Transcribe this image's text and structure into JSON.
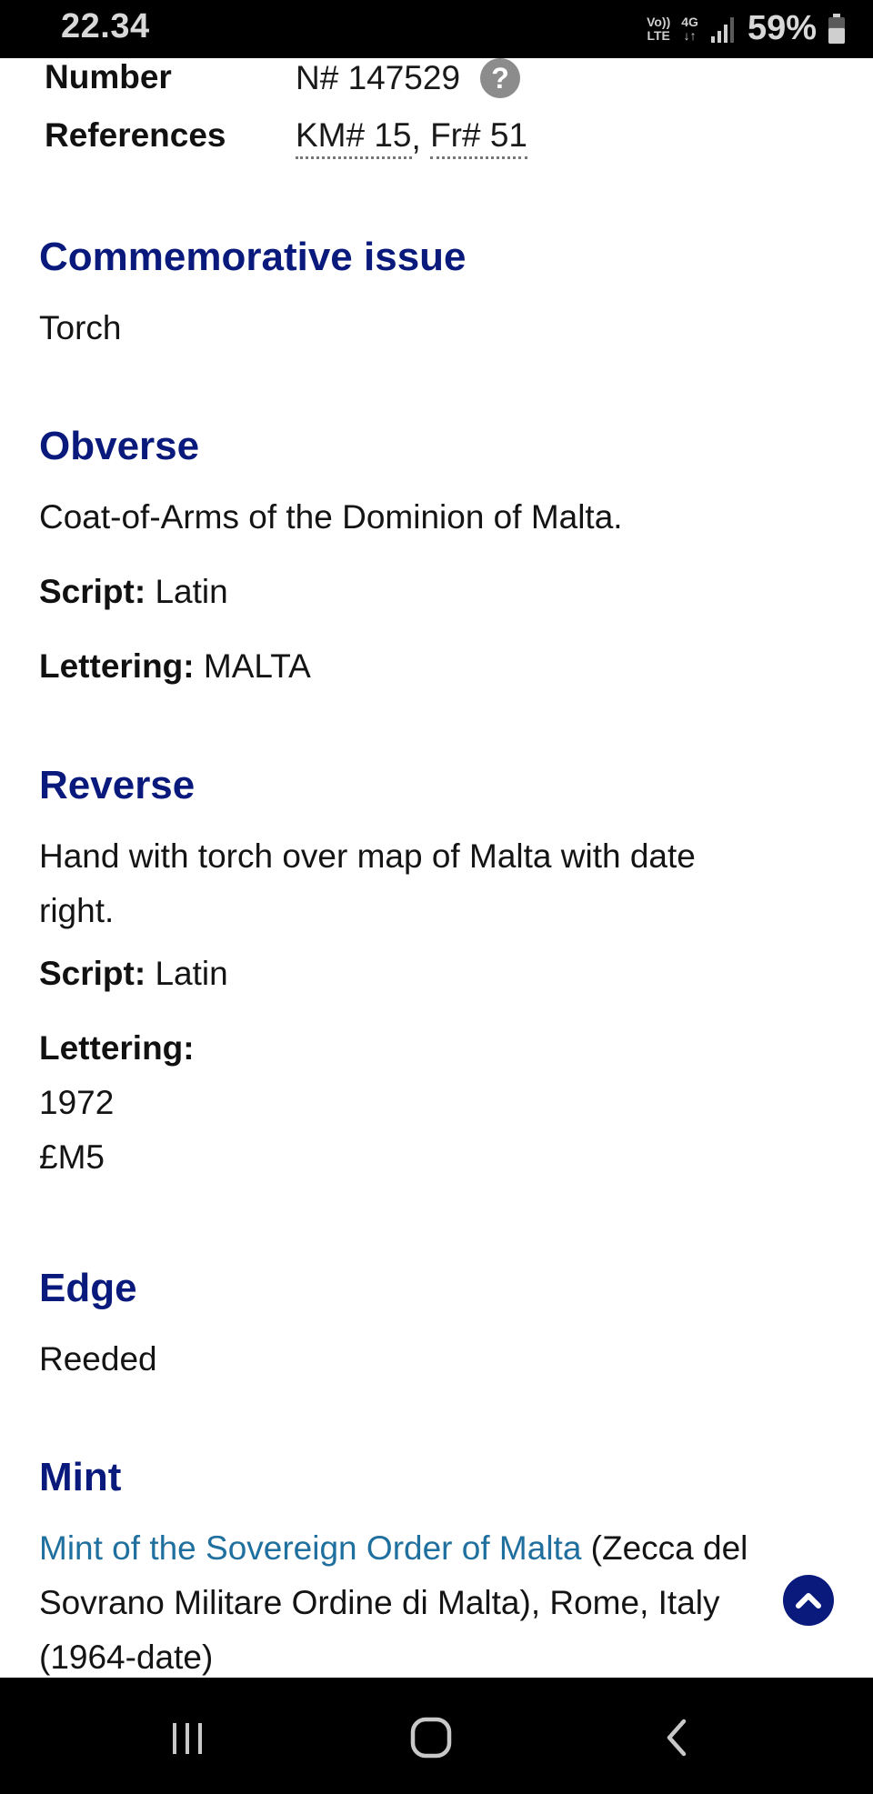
{
  "status_bar": {
    "time": "22.34",
    "volte_line1": "Vo))",
    "volte_line2": "LTE",
    "network_line1": "4G",
    "network_line2": "↓↑",
    "battery_percent": "59%",
    "battery_level": 0.59
  },
  "details": {
    "number_label": "Number",
    "number_value": "N# 147529",
    "references_label": "References",
    "references": [
      "KM# 15",
      "Fr# 51"
    ],
    "references_separator": ","
  },
  "commemorative": {
    "heading": "Commemorative issue",
    "text": "Torch"
  },
  "obverse": {
    "heading": "Obverse",
    "description": "Coat-of-Arms of the Dominion of Malta.",
    "script_label": "Script:",
    "script_value": "Latin",
    "lettering_label": "Lettering:",
    "lettering_value": "MALTA"
  },
  "reverse": {
    "heading": "Reverse",
    "description_line1": "Hand with torch over map of Malta with date",
    "description_line2": "right.",
    "script_label": "Script:",
    "script_value": "Latin",
    "lettering_label": "Lettering:",
    "lettering_lines": [
      "1972",
      "£M5"
    ]
  },
  "edge": {
    "heading": "Edge",
    "text": "Reeded"
  },
  "mint": {
    "heading": "Mint",
    "link_text": "Mint of the Sovereign Order of Malta",
    "text_after_link_line1": " (Zecca del",
    "line2": "Sovrano Militare Ordine di Malta), Rome, Italy",
    "line3": "(1964-date)"
  },
  "colors": {
    "heading": "#0a1a7c",
    "link": "#1f6f9f",
    "help_icon": "#8c8c8c",
    "scroll_top_button": "#0a1a7c"
  },
  "icons": {
    "help": "question-mark-circle",
    "scroll_top": "chevron-up-circle",
    "nav_recents": "three-vertical-bars",
    "nav_home": "rounded-square-outline",
    "nav_back": "chevron-left"
  },
  "help_glyph": "?"
}
